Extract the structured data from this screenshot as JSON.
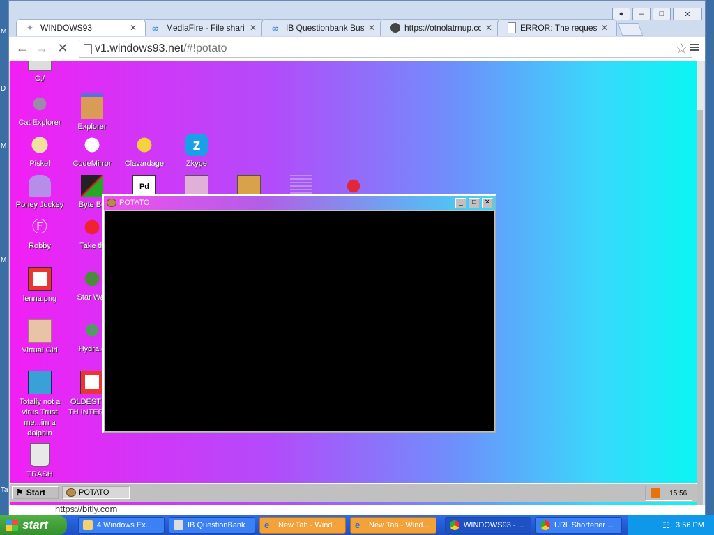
{
  "xp_desktop": {
    "letters": [
      "M",
      "D",
      "M",
      "M",
      "Ta"
    ]
  },
  "chrome": {
    "tabs": [
      {
        "title": "WINDOWS93",
        "icon": "windows93-icon",
        "active": true
      },
      {
        "title": "MediaFire - File sharing a",
        "icon": "mediafire-icon",
        "active": false
      },
      {
        "title": "IB Questionbank Busine",
        "icon": "mediafire-icon",
        "active": false
      },
      {
        "title": "https://otnolatrnup.com",
        "icon": "globe-icon",
        "active": false
      },
      {
        "title": "ERROR: The requested",
        "icon": "document-icon",
        "active": false
      }
    ],
    "url_host": "v1.windows93.net",
    "url_path": "/#!potato"
  },
  "desktop_icons": [
    {
      "label": "C:/"
    },
    {
      "label": "Cat Explorer"
    },
    {
      "label": "Explorer"
    },
    {
      "label": "Piskel"
    },
    {
      "label": "CodeMirror"
    },
    {
      "label": "Clavardage"
    },
    {
      "label": "Zkype"
    },
    {
      "label": "Poney Jockey"
    },
    {
      "label": "Byte Be"
    },
    {
      "label": "Robby"
    },
    {
      "label": "Take th"
    },
    {
      "label": "lenna.png"
    },
    {
      "label": "Star War"
    },
    {
      "label": "Virtual Girl"
    },
    {
      "label": "Hydra.e"
    },
    {
      "label": "Totally not a virus.Trust me...im a dolphin"
    },
    {
      "label": "OLDEST OF TH INTERWE"
    },
    {
      "label": "TRASH"
    }
  ],
  "potato_window": {
    "title": "POTATO"
  },
  "w93_taskbar": {
    "start": "Start",
    "task": "POTATO",
    "clock": "15:56"
  },
  "download_bar": {
    "text": "https://bitly.com"
  },
  "xp_taskbar": {
    "start": "start",
    "tasks": [
      {
        "label": "4 Windows Ex..."
      },
      {
        "label": "IB QuestionBank"
      },
      {
        "label": "New Tab - Wind..."
      },
      {
        "label": "New Tab - Wind..."
      },
      {
        "label": "WINDOWS93 - ..."
      },
      {
        "label": "URL Shortener ..."
      }
    ],
    "clock": "3:56 PM"
  },
  "colors": {
    "gradient_left": "#f21ff4",
    "gradient_right": "#07f7f2",
    "xp_blue": "#245edb"
  }
}
